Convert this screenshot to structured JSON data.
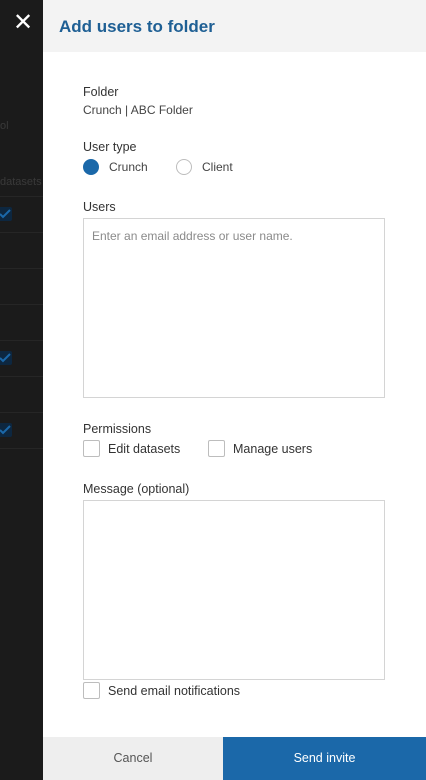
{
  "backdrop": {
    "close_glyph": "✕",
    "fragment_1": "ol",
    "fragment_2": "datasets"
  },
  "panel": {
    "title": "Add users to folder"
  },
  "folder": {
    "label": "Folder",
    "value": "Crunch | ABC Folder"
  },
  "user_type": {
    "label": "User type",
    "options": [
      "Crunch",
      "Client"
    ],
    "selected": "Crunch"
  },
  "users": {
    "label": "Users",
    "placeholder": "Enter an email address or user name.",
    "value": ""
  },
  "permissions": {
    "label": "Permissions",
    "edit_datasets": "Edit datasets",
    "manage_users": "Manage users"
  },
  "message": {
    "label": "Message (optional)",
    "value": ""
  },
  "notifications": {
    "label": "Send email notifications"
  },
  "footer": {
    "cancel_label": "Cancel",
    "send_label": "Send invite"
  },
  "colors": {
    "accent": "#1b68a9",
    "title": "#1e5f94",
    "header_bg": "#f3f3f3",
    "backdrop": "#1b1b1b"
  }
}
